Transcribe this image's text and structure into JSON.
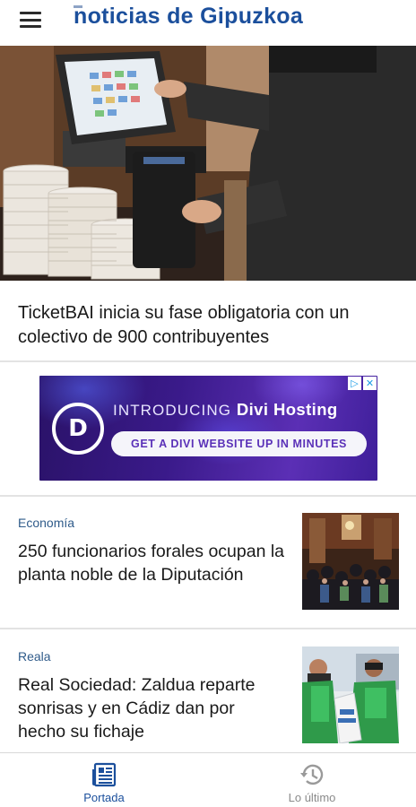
{
  "header": {
    "menu_icon": "hamburger-menu-icon",
    "logo_text": "noticias de Gipuzkoa"
  },
  "hero": {
    "title": "TicketBAI inicia su fase obligatoria con un colectivo de 900 contribuyentes"
  },
  "ad": {
    "headline_prefix": "INTRODUCING ",
    "headline_brand": "Divi Hosting",
    "cta": "GET A DIVI WEBSITE UP IN MINUTES",
    "logo_letter": "D",
    "choices_icon": "ad-choices-icon"
  },
  "articles": [
    {
      "category": "Economía",
      "title": "250 funcionarios forales ocupan la planta noble de la Diputación"
    },
    {
      "category": "Reala",
      "title": "Real Sociedad: Zaldua reparte sonrisas y en Cádiz dan por hecho su fichaje"
    }
  ],
  "bottom_nav": {
    "items": [
      {
        "label": "Portada",
        "icon": "newspaper-icon",
        "active": true
      },
      {
        "label": "Lo último",
        "icon": "history-clock-icon",
        "active": false
      }
    ]
  },
  "colors": {
    "brand": "#1b4f9c",
    "category": "#2f5b8a",
    "ad_purple": "#3a1a8a"
  }
}
